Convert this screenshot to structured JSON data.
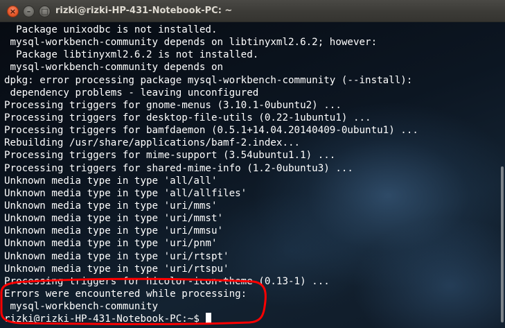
{
  "window": {
    "title": "rizki@rizki-HP-431-Notebook-PC: ~",
    "buttons": {
      "close_glyph": "×",
      "minimize_glyph": "–",
      "maximize_glyph": "□"
    }
  },
  "terminal": {
    "lines": [
      "  Package unixodbc is not installed.",
      " mysql-workbench-community depends on libtinyxml2.6.2; however:",
      "  Package libtinyxml2.6.2 is not installed.",
      " mysql-workbench-community depends on",
      "dpkg: error processing package mysql-workbench-community (--install):",
      " dependency problems - leaving unconfigured",
      "Processing triggers for gnome-menus (3.10.1-0ubuntu2) ...",
      "Processing triggers for desktop-file-utils (0.22-1ubuntu1) ...",
      "Processing triggers for bamfdaemon (0.5.1+14.04.20140409-0ubuntu1) ...",
      "Rebuilding /usr/share/applications/bamf-2.index...",
      "Processing triggers for mime-support (3.54ubuntu1.1) ...",
      "Processing triggers for shared-mime-info (1.2-0ubuntu3) ...",
      "Unknown media type in type 'all/all'",
      "Unknown media type in type 'all/allfiles'",
      "Unknown media type in type 'uri/mms'",
      "Unknown media type in type 'uri/mmst'",
      "Unknown media type in type 'uri/mmsu'",
      "Unknown media type in type 'uri/pnm'",
      "Unknown media type in type 'uri/rtspt'",
      "Unknown media type in type 'uri/rtspu'",
      "Processing triggers for hicolor-icon-theme (0.13-1) ...",
      "Errors were encountered while processing:",
      " mysql-workbench-community"
    ],
    "prompt": "rizki@rizki-HP-431-Notebook-PC:~$ "
  },
  "colors": {
    "text": "#ffffff",
    "titlebar": "#3c3b37",
    "close_button": "#e65a2c",
    "annotation": "#ff0000"
  }
}
